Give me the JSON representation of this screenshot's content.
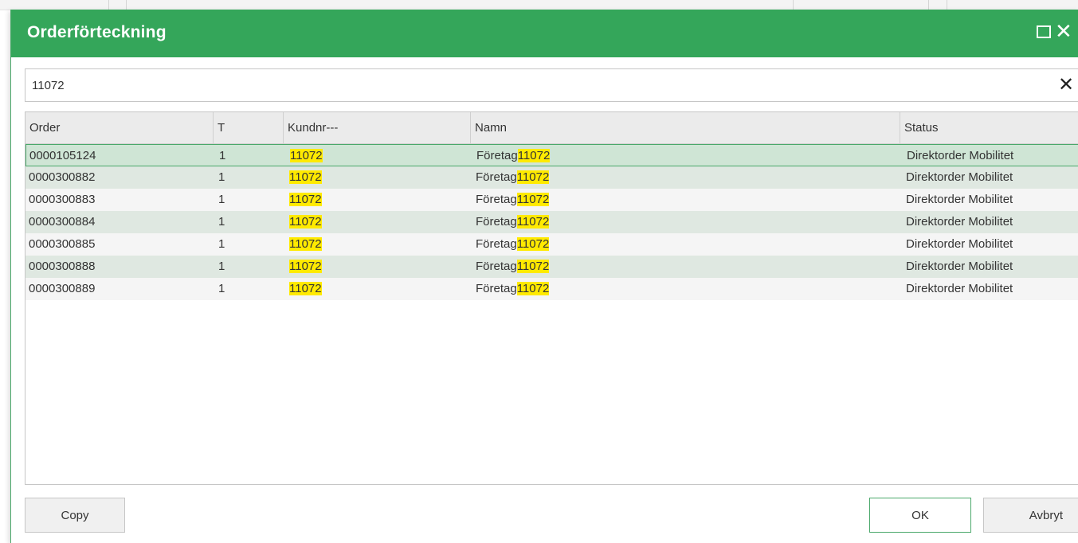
{
  "dialog": {
    "title": "Orderförteckning"
  },
  "search": {
    "value": "11072"
  },
  "grid": {
    "columns": [
      "Order",
      "T",
      "Kundnr---",
      "Namn",
      "Status"
    ],
    "rows": [
      {
        "order": "0000105124",
        "t": "1",
        "kundnr": "11072",
        "namn_prefix": "Företag",
        "namn_match": "11072",
        "status": "Direktorder Mobilitet"
      },
      {
        "order": "0000300882",
        "t": "1",
        "kundnr": "11072",
        "namn_prefix": "Företag",
        "namn_match": "11072",
        "status": "Direktorder Mobilitet"
      },
      {
        "order": "0000300883",
        "t": "1",
        "kundnr": "11072",
        "namn_prefix": "Företag",
        "namn_match": "11072",
        "status": "Direktorder Mobilitet"
      },
      {
        "order": "0000300884",
        "t": "1",
        "kundnr": "11072",
        "namn_prefix": "Företag",
        "namn_match": "11072",
        "status": "Direktorder Mobilitet"
      },
      {
        "order": "0000300885",
        "t": "1",
        "kundnr": "11072",
        "namn_prefix": "Företag",
        "namn_match": "11072",
        "status": "Direktorder Mobilitet"
      },
      {
        "order": "0000300888",
        "t": "1",
        "kundnr": "11072",
        "namn_prefix": "Företag",
        "namn_match": "11072",
        "status": "Direktorder Mobilitet"
      },
      {
        "order": "0000300889",
        "t": "1",
        "kundnr": "11072",
        "namn_prefix": "Företag",
        "namn_match": "11072",
        "status": "Direktorder Mobilitet"
      }
    ]
  },
  "buttons": {
    "copy": "Copy",
    "ok": "OK",
    "cancel": "Avbryt"
  },
  "icons": {
    "maximize": "maximize-icon",
    "close": "close-icon",
    "clear": "clear-icon"
  },
  "colors": {
    "titlebar": "#34a65a",
    "highlight": "#ffea00",
    "row_alt": "#dfe8e1",
    "selected_border": "#4aa86a"
  }
}
